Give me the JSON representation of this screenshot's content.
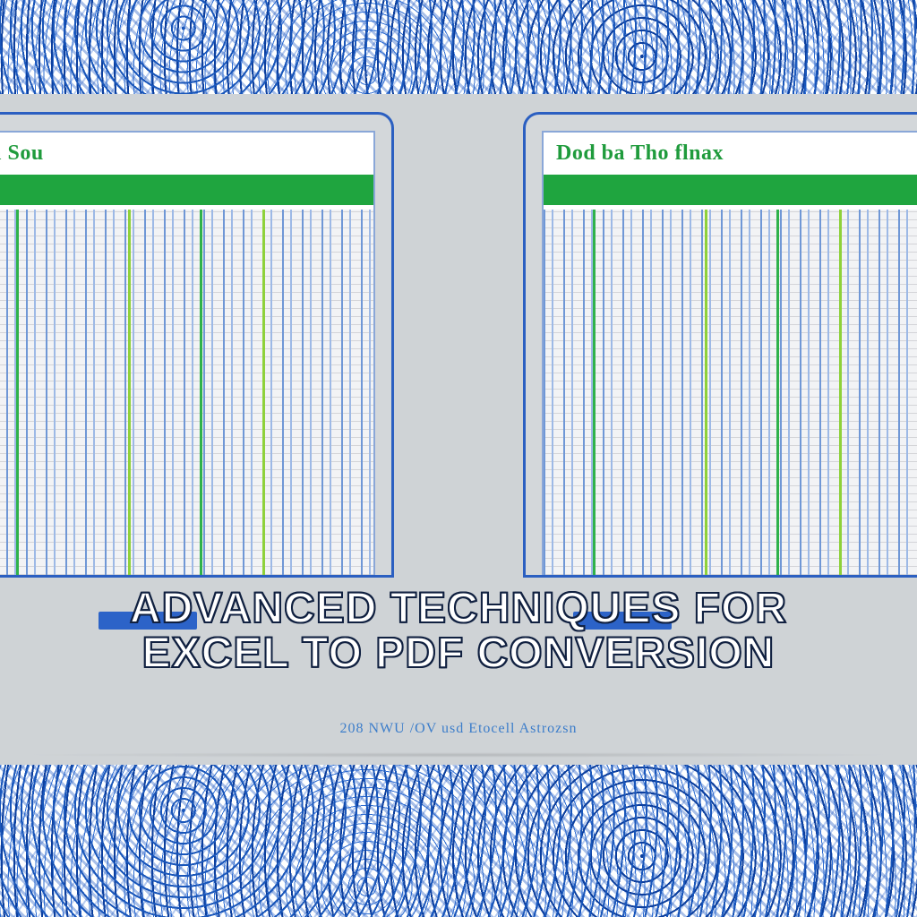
{
  "panels": {
    "left": {
      "title": "en Sou"
    },
    "right": {
      "title": "Dod ba Tho flnax"
    }
  },
  "headline": {
    "line1": "Advanced Techniques for",
    "line2": "Excel to PDF Conversion"
  },
  "footer_caption": "208 NWU /OV usd Etocell Astrozsn"
}
